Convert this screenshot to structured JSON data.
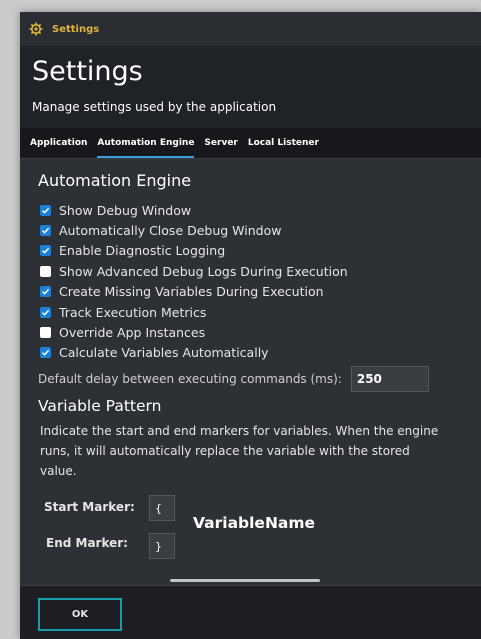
{
  "window": {
    "title": "Settings",
    "accent": "#e0b53a"
  },
  "header": {
    "title": "Settings",
    "subtitle": "Manage settings used by the application"
  },
  "tabs": [
    {
      "label": "Application",
      "active": false
    },
    {
      "label": "Automation Engine",
      "active": true
    },
    {
      "label": "Server",
      "active": false
    },
    {
      "label": "Local Listener",
      "active": false
    }
  ],
  "automation": {
    "title": "Automation Engine",
    "options": [
      {
        "label": "Show Debug Window",
        "checked": true
      },
      {
        "label": "Automatically Close Debug Window",
        "checked": true
      },
      {
        "label": "Enable Diagnostic Logging",
        "checked": true
      },
      {
        "label": "Show Advanced Debug Logs During Execution",
        "checked": false
      },
      {
        "label": "Create Missing Variables During Execution",
        "checked": true
      },
      {
        "label": "Track Execution Metrics",
        "checked": true
      },
      {
        "label": "Override App Instances",
        "checked": false
      },
      {
        "label": "Calculate Variables Automatically",
        "checked": true
      }
    ],
    "delay_label": "Default delay between executing commands (ms):",
    "delay_value": "250"
  },
  "variable_pattern": {
    "title": "Variable Pattern",
    "description": "Indicate the start and end markers for variables.  When the engine runs, it will automatically replace the variable with the stored value.",
    "start_label": "Start Marker:",
    "start_value": "{",
    "end_label": "End Marker:",
    "end_value": "}",
    "example": "VariableName"
  },
  "footer": {
    "ok_label": "OK"
  },
  "colors": {
    "checkbox_on": "#1e7fd6",
    "tab_underline": "#3b9fe0",
    "ok_border": "#1a9bb0"
  }
}
